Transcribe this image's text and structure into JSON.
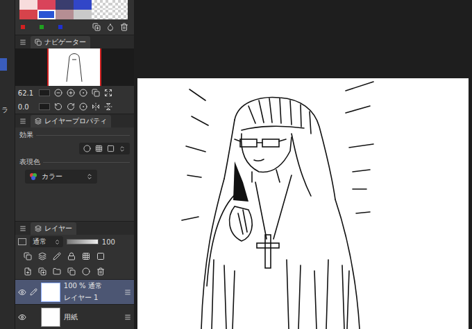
{
  "left_strip": {
    "label": "ラ"
  },
  "palette": {
    "swatches": [
      {
        "kind": "color",
        "color": "#f7dcdc",
        "selected": false
      },
      {
        "kind": "color",
        "color": "#d9435a",
        "selected": false
      },
      {
        "kind": "color",
        "color": "#3a3d6e",
        "selected": false
      },
      {
        "kind": "color",
        "color": "#3146c8",
        "selected": false
      },
      {
        "kind": "transparent",
        "color": "#ffffff",
        "selected": false
      },
      {
        "kind": "transparent",
        "color": "#ffffff",
        "selected": false
      },
      {
        "kind": "color",
        "color": "#d6434b",
        "selected": false
      },
      {
        "kind": "color",
        "color": "#2a55d4",
        "selected": true
      },
      {
        "kind": "color",
        "color": "#b58e93",
        "selected": false
      },
      {
        "kind": "color",
        "color": "#c9c9c9",
        "selected": false
      },
      {
        "kind": "transparent",
        "color": "#ffffff",
        "selected": false
      },
      {
        "kind": "transparent",
        "color": "#ffffff",
        "selected": false
      }
    ],
    "channels": [
      {
        "color": "#d22020"
      },
      {
        "color": "#20a020"
      },
      {
        "color": "#2030d0"
      }
    ]
  },
  "navigator": {
    "title": "ナビゲーター",
    "zoom": "62.1",
    "rotation": "0.0"
  },
  "layer_property": {
    "title": "レイヤープロパティ",
    "effect_label": "効果",
    "color_label": "表現色",
    "color_mode": "カラー"
  },
  "layers": {
    "title": "レイヤー",
    "blend_mode": "通常",
    "opacity": "100",
    "opacity_level": 1,
    "items": [
      {
        "name": "レイヤー 1",
        "info": "100 % 通常",
        "selected": true,
        "visible": true
      },
      {
        "name": "用紙",
        "selected": false,
        "visible": true
      }
    ]
  }
}
